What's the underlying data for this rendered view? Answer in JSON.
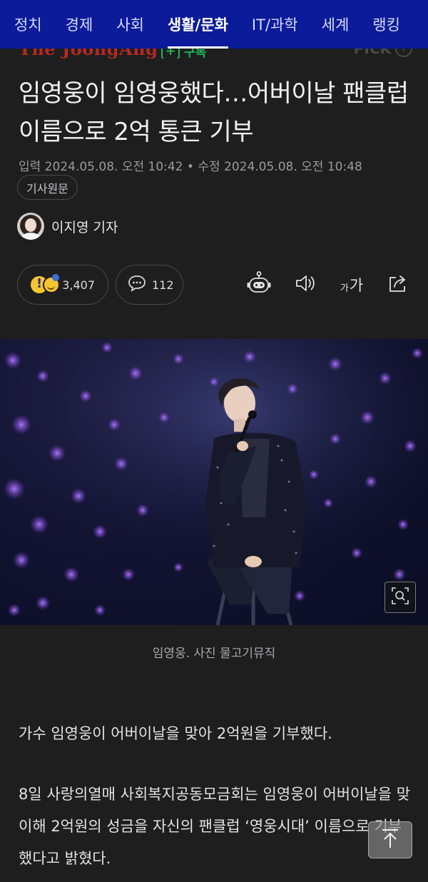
{
  "nav": {
    "items": [
      "정치",
      "경제",
      "사회",
      "생활/문화",
      "IT/과학",
      "세계",
      "랭킹"
    ],
    "active_index": 3
  },
  "press": {
    "logo_text": "The JoongAng",
    "subscribe_label": "구독",
    "pick_label": "PICK"
  },
  "article": {
    "headline": "임영웅이 임영웅했다…어버이날 팬클럽 이름으로 2억 통큰 기부",
    "dates": "입력 2024.05.08. 오전 10:42 • 수정 2024.05.08. 오전 10:48",
    "original_button": "기사원문",
    "reporter": "이지영 기자",
    "reactions_count": "3,407",
    "comments_count": "112",
    "font_size_label_small": "가",
    "font_size_label_large": "가",
    "photo_caption": "임영웅. 사진 물고기뮤직",
    "paragraph1": "가수 임영웅이 어버이날을 맞아 2억원을 기부했다.",
    "paragraph2": "8일 사랑의열매 사회복지공동모금회는 임영웅이 어버이날을 맞이해 2억원의 성금을 자신의 팬클럽 ‘영웅시대’ 이름으로 기부했다고 밝혔다."
  },
  "colors": {
    "nav_bg": "#0b1b9a",
    "page_bg": "#1e1e1f",
    "subscribe_green": "#1fb55a",
    "logo_red": "#b42a20"
  }
}
